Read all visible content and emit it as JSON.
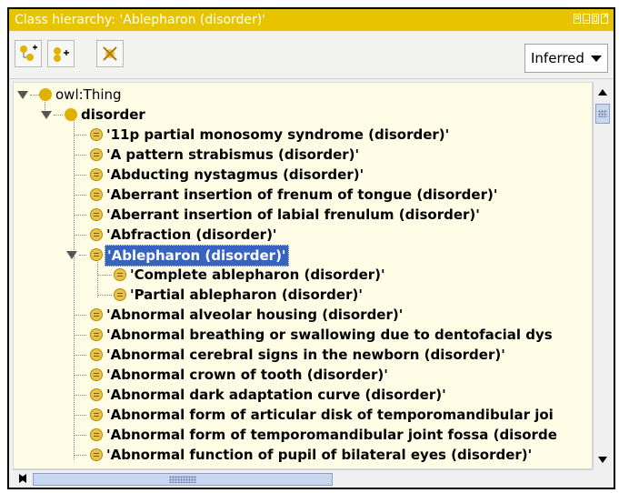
{
  "window": {
    "title": "Class hierarchy: 'Ablepharon (disorder)'"
  },
  "toolbar": {
    "add_subclass_icon": "add-subclass-icon",
    "add_sibling_icon": "add-sibling-icon",
    "delete_class_icon": "delete-class-icon",
    "view_mode": {
      "selected": "Inferred"
    }
  },
  "colors": {
    "titlebar": "#e8c400",
    "tree_background": "#fffde6",
    "selection": "#3764c0",
    "class_bullet": "#e9c24a"
  },
  "tree": {
    "root": "owl:Thing",
    "disorder": "disorder",
    "items": [
      "'11p partial monosomy syndrome (disorder)'",
      "'A pattern strabismus (disorder)'",
      "'Abducting nystagmus (disorder)'",
      "'Aberrant insertion of frenum of tongue (disorder)'",
      "'Aberrant insertion of labial frenulum (disorder)'",
      "'Abfraction (disorder)'",
      "'Ablepharon (disorder)'",
      "'Complete ablepharon (disorder)'",
      "'Partial ablepharon (disorder)'",
      "'Abnormal alveolar housing (disorder)'",
      "'Abnormal breathing or swallowing due to dentofacial dys",
      "'Abnormal cerebral signs in the newborn (disorder)'",
      "'Abnormal crown of tooth (disorder)'",
      "'Abnormal dark adaptation curve (disorder)'",
      "'Abnormal form of articular disk of temporomandibular joi",
      "'Abnormal form of temporomandibular joint fossa (disorde",
      "'Abnormal function of pupil of bilateral eyes (disorder)'"
    ],
    "selected_item": "'Ablepharon (disorder)'"
  }
}
